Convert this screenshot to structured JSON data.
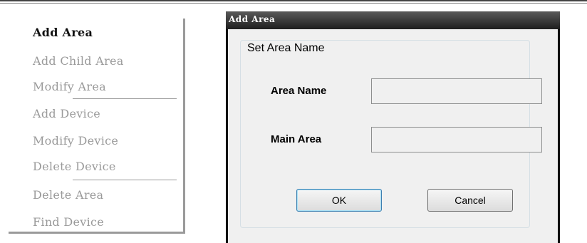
{
  "context_menu": {
    "items": [
      {
        "label": "Add Area",
        "enabled": true
      },
      {
        "label": "Add Child Area",
        "enabled": false
      },
      {
        "label": "Modify Area",
        "enabled": false
      },
      {
        "label": "Add Device",
        "enabled": false
      },
      {
        "label": "Modify Device",
        "enabled": false
      },
      {
        "label": "Delete Device",
        "enabled": false
      },
      {
        "label": "Delete Area",
        "enabled": false
      },
      {
        "label": "Find Device",
        "enabled": false
      }
    ]
  },
  "dialog": {
    "title": "Add Area",
    "group_title": "Set Area Name",
    "area_name_label": "Area Name",
    "area_name_value": "",
    "main_area_label": "Main Area",
    "main_area_value": "",
    "ok_label": "OK",
    "cancel_label": "Cancel"
  }
}
